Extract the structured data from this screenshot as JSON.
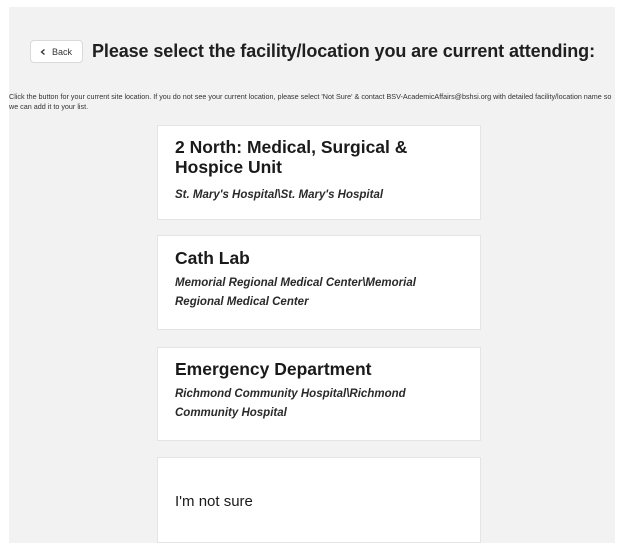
{
  "header": {
    "back_label": "Back",
    "title": "Please select the facility/location you are current attending:"
  },
  "instructions": "Click the button for your current site location. If you do not see your current location, please select 'Not Sure' & contact BSV-AcademicAffairs@bshsi.org with detailed facility/location name so we can add it to your list.",
  "locations": [
    {
      "name": "2 North: Medical, Surgical & Hospice Unit",
      "site": "St. Mary's Hospital\\St. Mary's Hospital"
    },
    {
      "name": "Cath Lab",
      "site": "Memorial Regional Medical Center\\Memorial Regional Medical Center"
    },
    {
      "name": "Emergency Department",
      "site": "Richmond Community Hospital\\Richmond Community Hospital"
    },
    {
      "name": "I'm not sure"
    }
  ],
  "colors": {
    "page_background": "#f2f2f2",
    "card_background": "#ffffff"
  }
}
